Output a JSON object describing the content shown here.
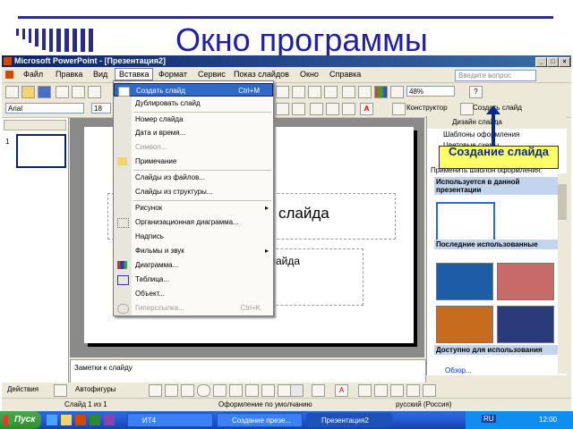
{
  "slide_title": "Окно программы",
  "window": {
    "title": "Microsoft PowerPoint - [Презентация2]",
    "help_placeholder": "Введите вопрос"
  },
  "menubar": [
    "Файл",
    "Правка",
    "Вид",
    "Вставка",
    "Формат",
    "Сервис",
    "Показ слайдов",
    "Окно",
    "Справка"
  ],
  "toolbar": {
    "zoom": "48%",
    "font": "Arial",
    "size": "18",
    "designer_label": "Конструктор",
    "new_slide_label": "Создать слайд"
  },
  "insert_menu": {
    "items": [
      {
        "label": "Создать слайд",
        "shortcut": "Ctrl+M"
      },
      {
        "label": "Дублировать слайд"
      },
      {
        "label": "Номер слайда"
      },
      {
        "label": "Дата и время..."
      },
      {
        "label": "Символ..."
      },
      {
        "label": "Примечание"
      },
      {
        "label": "Слайды из файлов..."
      },
      {
        "label": "Слайды из структуры..."
      },
      {
        "label": "Рисунок"
      },
      {
        "label": "Организационная диаграмма..."
      },
      {
        "label": "Надпись"
      },
      {
        "label": "Фильмы и звук"
      },
      {
        "label": "Диаграмма..."
      },
      {
        "label": "Таблица..."
      },
      {
        "label": "Объект..."
      },
      {
        "label": "Гиперссылка...",
        "shortcut": "Ctrl+K"
      }
    ]
  },
  "slide": {
    "title_placeholder": "слайда",
    "subtitle_placeholder": "слайда"
  },
  "slide_panel": {
    "number": "1"
  },
  "task_pane": {
    "title": "Дизайн слайда",
    "links": [
      "Шаблоны оформления",
      "Цветовые схемы"
    ],
    "apply_label": "Применить шаблон оформления:",
    "sections": [
      "Используется в данной презентации",
      "Последние использованные",
      "Доступно для использования"
    ],
    "browse": "Обзор..."
  },
  "callout": {
    "text": "Создание слайда"
  },
  "notes": {
    "placeholder": "Заметки к слайду"
  },
  "drawing": {
    "actions": "Действия",
    "autoshapes": "Автофигуры"
  },
  "statusbar": {
    "slide": "Слайд 1 из 1",
    "design": "Оформление по умолчанию",
    "language": "русский (Россия)"
  },
  "taskbar": {
    "start": "Пуск",
    "tasks": [
      "ИТ4",
      "Создание презе...",
      "Презентация2"
    ],
    "lang": "RU",
    "clock": "12:00"
  }
}
